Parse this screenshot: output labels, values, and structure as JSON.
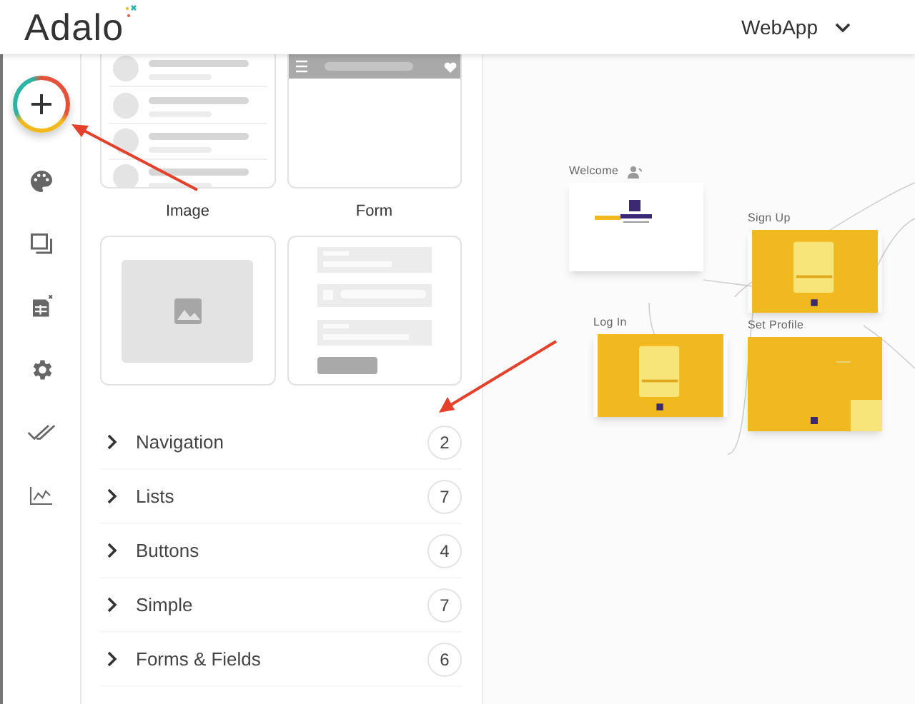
{
  "header": {
    "logo": "Adalo",
    "app_name": "WebApp"
  },
  "rail": [
    {
      "kind": "add"
    },
    {
      "kind": "palette"
    },
    {
      "kind": "screens"
    },
    {
      "kind": "database"
    },
    {
      "kind": "settings"
    },
    {
      "kind": "checks"
    },
    {
      "kind": "analytics"
    }
  ],
  "tiles": [
    {
      "kind": "list"
    },
    {
      "kind": "app-bar"
    },
    {
      "kind": "image",
      "label": "Image"
    },
    {
      "kind": "form",
      "label": "Form"
    }
  ],
  "categories": [
    {
      "label": "Navigation",
      "count": "2"
    },
    {
      "label": "Lists",
      "count": "7"
    },
    {
      "label": "Buttons",
      "count": "4"
    },
    {
      "label": "Simple",
      "count": "7"
    },
    {
      "label": "Forms & Fields",
      "count": "6"
    }
  ],
  "canvas": {
    "screens": [
      {
        "title": "Welcome",
        "kind": "welcome",
        "home": true
      },
      {
        "title": "Sign Up",
        "kind": "form",
        "home": false
      },
      {
        "title": "Log In",
        "kind": "form",
        "home": false
      },
      {
        "title": "Set Profile",
        "kind": "profile",
        "home": false
      }
    ]
  }
}
